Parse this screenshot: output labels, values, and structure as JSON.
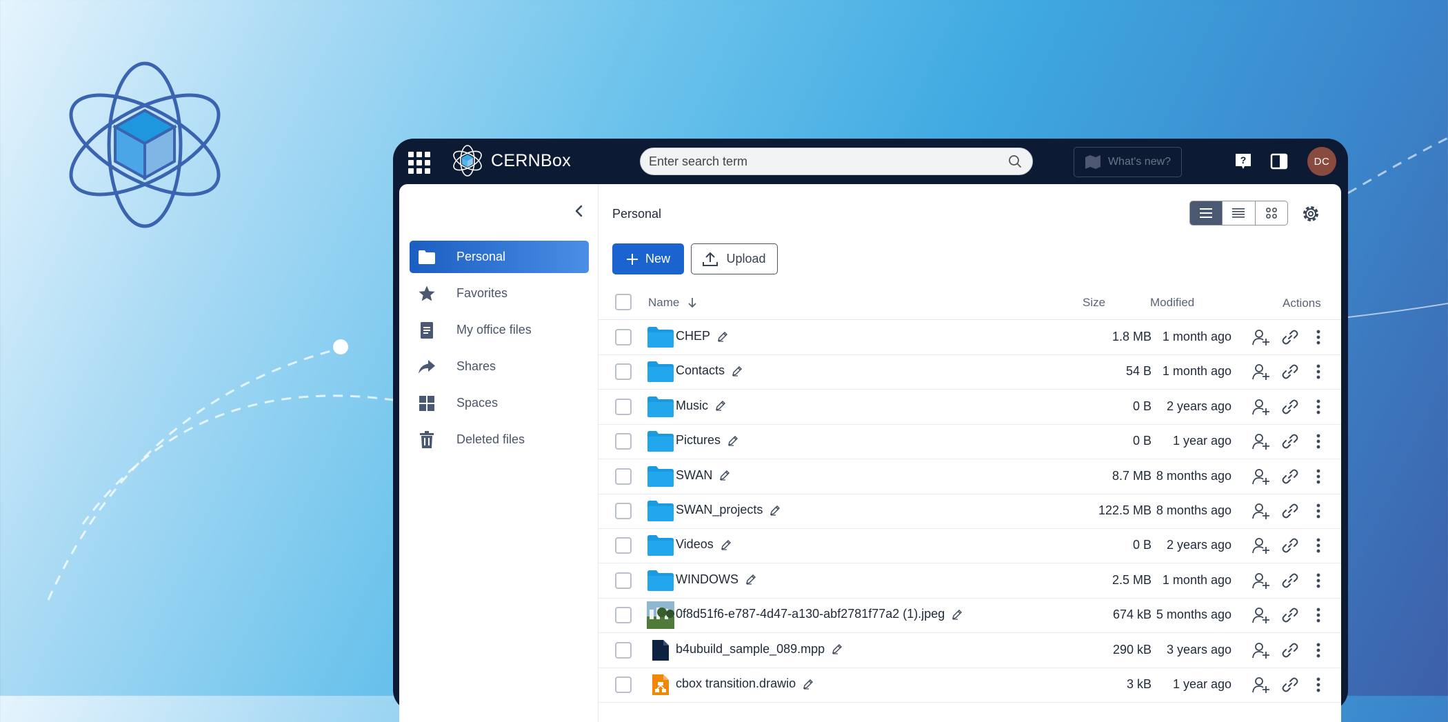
{
  "topbar": {
    "app_name": "CERNBox",
    "search_placeholder": "Enter search term",
    "whats_new": "What's new?",
    "avatar_initials": "DC"
  },
  "sidebar": {
    "items": [
      {
        "label": "Personal",
        "icon": "folder-icon",
        "active": true
      },
      {
        "label": "Favorites",
        "icon": "star-icon"
      },
      {
        "label": "My office files",
        "icon": "document-icon"
      },
      {
        "label": "Shares",
        "icon": "share-arrow-icon"
      },
      {
        "label": "Spaces",
        "icon": "grid-icon"
      },
      {
        "label": "Deleted files",
        "icon": "trash-icon"
      }
    ]
  },
  "main": {
    "breadcrumb": "Personal",
    "new_label": "New",
    "upload_label": "Upload",
    "columns": {
      "name": "Name",
      "size": "Size",
      "modified": "Modified",
      "actions": "Actions"
    },
    "files": [
      {
        "name": "CHEP",
        "type": "folder",
        "size": "1.8 MB",
        "modified": "1 month ago"
      },
      {
        "name": "Contacts",
        "type": "folder",
        "size": "54 B",
        "modified": "1 month ago"
      },
      {
        "name": "Music",
        "type": "folder",
        "size": "0 B",
        "modified": "2 years ago"
      },
      {
        "name": "Pictures",
        "type": "folder",
        "size": "0 B",
        "modified": "1 year ago"
      },
      {
        "name": "SWAN",
        "type": "folder",
        "size": "8.7 MB",
        "modified": "8 months ago"
      },
      {
        "name": "SWAN_projects",
        "type": "folder",
        "size": "122.5 MB",
        "modified": "8 months ago"
      },
      {
        "name": "Videos",
        "type": "folder",
        "size": "0 B",
        "modified": "2 years ago"
      },
      {
        "name": "WINDOWS",
        "type": "folder",
        "size": "2.5 MB",
        "modified": "1 month ago"
      },
      {
        "name": "0f8d51f6-e787-4d47-a130-abf2781f77a2 (1).jpeg",
        "type": "image",
        "size": "674 kB",
        "modified": "5 months ago"
      },
      {
        "name": "b4ubuild_sample_089.mpp",
        "type": "file",
        "size": "290 kB",
        "modified": "3 years ago"
      },
      {
        "name": "cbox transition.drawio",
        "type": "drawio",
        "size": "3 kB",
        "modified": "1 year ago"
      }
    ]
  },
  "colors": {
    "accent": "#1b64d0",
    "topbar": "#0d1a33",
    "folder": "#1a9ae0",
    "drawio": "#f08705",
    "avatar": "#8a4b3f"
  }
}
